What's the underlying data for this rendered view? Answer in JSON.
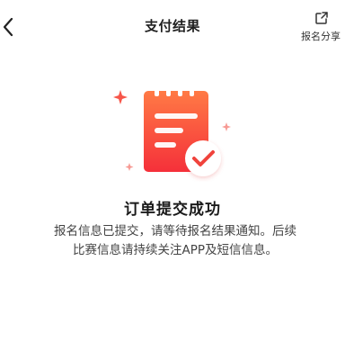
{
  "header": {
    "title": "支付结果",
    "back_icon": "chevron-left-icon",
    "share_label": "报名分享",
    "share_icon": "share-icon"
  },
  "illustration": {
    "icon": "clipboard-check-icon",
    "colors": {
      "clipboard_top": "#ff7a45",
      "clipboard_bottom": "#f5303a",
      "check": "#f0433c",
      "sparkle": "#f7564a"
    }
  },
  "result": {
    "title": "订单提交成功",
    "description_line1": "报名信息已提交，请等待报名结果通知。后续",
    "description_line2": "比赛信息请持续关注APP及短信信息。"
  }
}
